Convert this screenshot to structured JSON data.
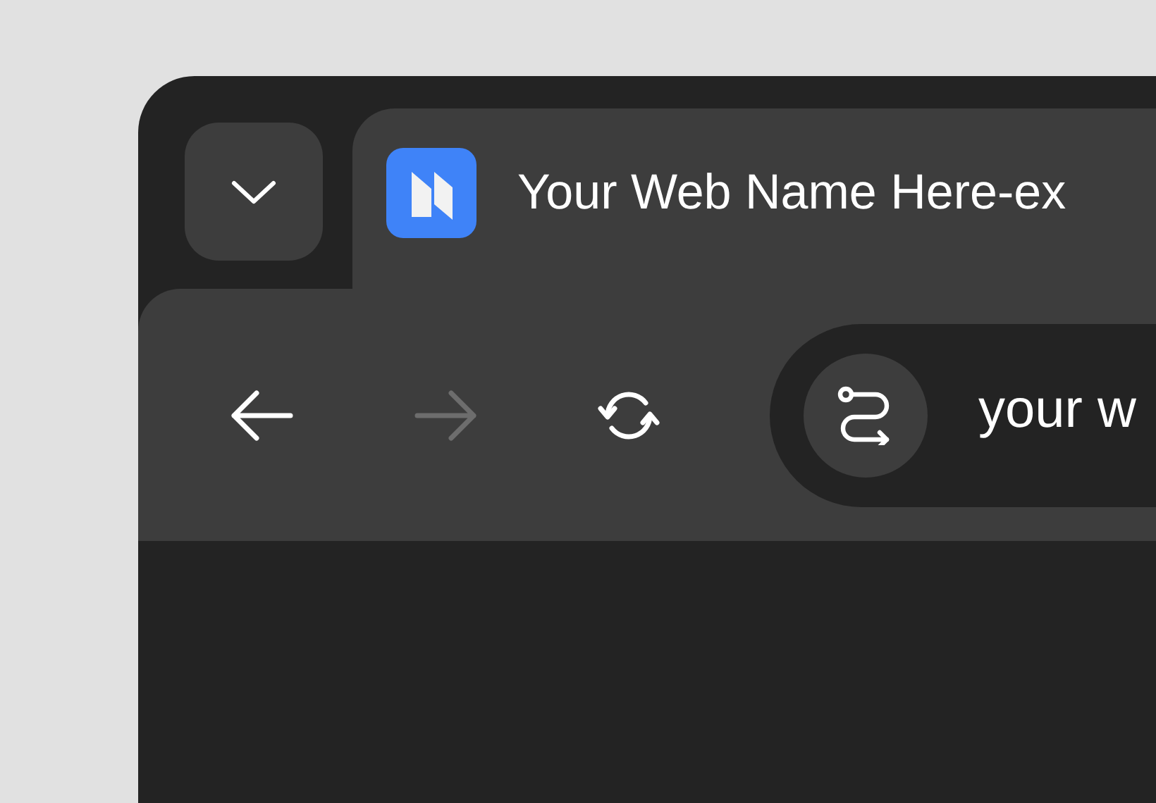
{
  "tab": {
    "title": "Your Web Name Here-ex"
  },
  "nav_buttons": [
    {
      "kind": "back",
      "disabled": false
    },
    {
      "kind": "forward",
      "disabled": true
    },
    {
      "kind": "reload",
      "disabled": false
    }
  ],
  "address_bar": {
    "value": "your w"
  }
}
